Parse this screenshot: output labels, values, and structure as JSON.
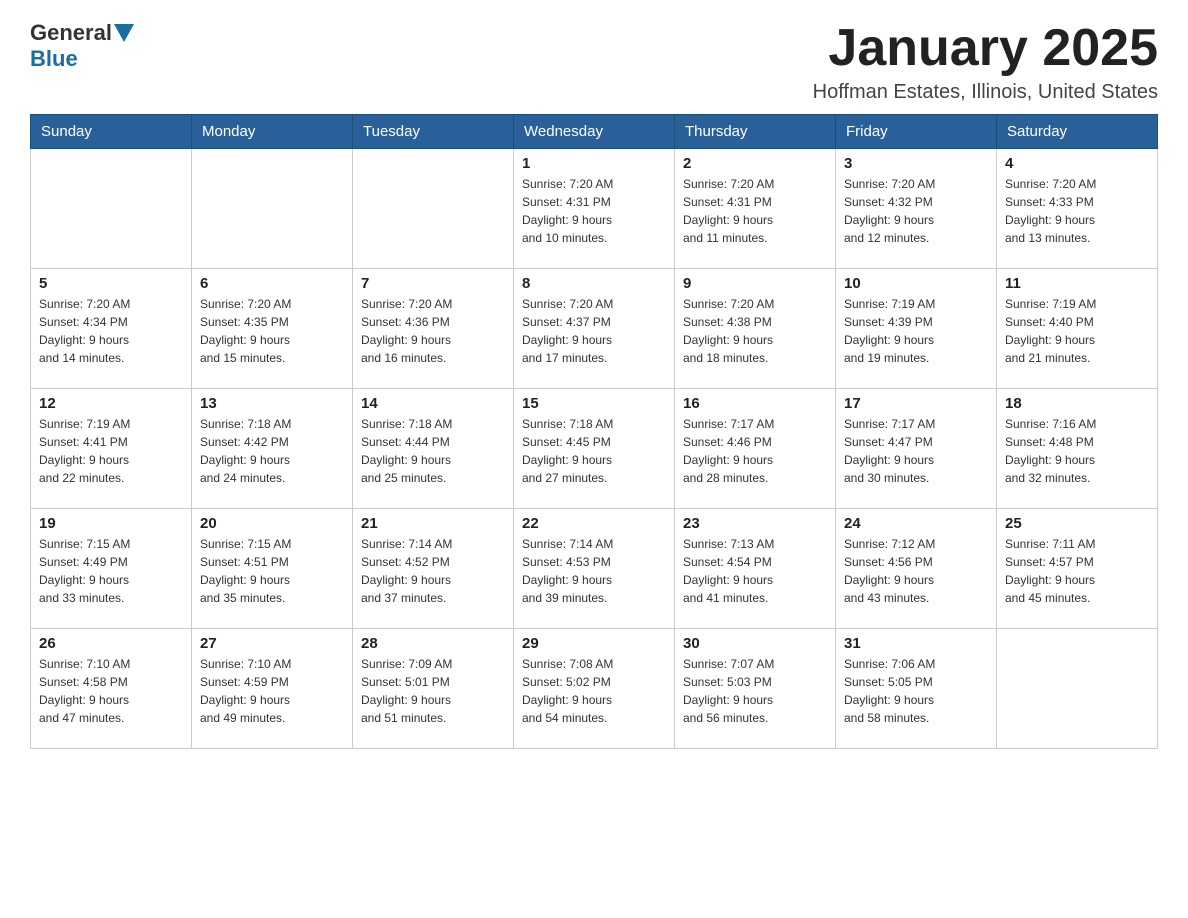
{
  "header": {
    "logo_general": "General",
    "logo_blue": "Blue",
    "month_title": "January 2025",
    "location": "Hoffman Estates, Illinois, United States"
  },
  "columns": [
    "Sunday",
    "Monday",
    "Tuesday",
    "Wednesday",
    "Thursday",
    "Friday",
    "Saturday"
  ],
  "weeks": [
    {
      "days": [
        {
          "date": "",
          "info": ""
        },
        {
          "date": "",
          "info": ""
        },
        {
          "date": "",
          "info": ""
        },
        {
          "date": "1",
          "info": "Sunrise: 7:20 AM\nSunset: 4:31 PM\nDaylight: 9 hours\nand 10 minutes."
        },
        {
          "date": "2",
          "info": "Sunrise: 7:20 AM\nSunset: 4:31 PM\nDaylight: 9 hours\nand 11 minutes."
        },
        {
          "date": "3",
          "info": "Sunrise: 7:20 AM\nSunset: 4:32 PM\nDaylight: 9 hours\nand 12 minutes."
        },
        {
          "date": "4",
          "info": "Sunrise: 7:20 AM\nSunset: 4:33 PM\nDaylight: 9 hours\nand 13 minutes."
        }
      ]
    },
    {
      "days": [
        {
          "date": "5",
          "info": "Sunrise: 7:20 AM\nSunset: 4:34 PM\nDaylight: 9 hours\nand 14 minutes."
        },
        {
          "date": "6",
          "info": "Sunrise: 7:20 AM\nSunset: 4:35 PM\nDaylight: 9 hours\nand 15 minutes."
        },
        {
          "date": "7",
          "info": "Sunrise: 7:20 AM\nSunset: 4:36 PM\nDaylight: 9 hours\nand 16 minutes."
        },
        {
          "date": "8",
          "info": "Sunrise: 7:20 AM\nSunset: 4:37 PM\nDaylight: 9 hours\nand 17 minutes."
        },
        {
          "date": "9",
          "info": "Sunrise: 7:20 AM\nSunset: 4:38 PM\nDaylight: 9 hours\nand 18 minutes."
        },
        {
          "date": "10",
          "info": "Sunrise: 7:19 AM\nSunset: 4:39 PM\nDaylight: 9 hours\nand 19 minutes."
        },
        {
          "date": "11",
          "info": "Sunrise: 7:19 AM\nSunset: 4:40 PM\nDaylight: 9 hours\nand 21 minutes."
        }
      ]
    },
    {
      "days": [
        {
          "date": "12",
          "info": "Sunrise: 7:19 AM\nSunset: 4:41 PM\nDaylight: 9 hours\nand 22 minutes."
        },
        {
          "date": "13",
          "info": "Sunrise: 7:18 AM\nSunset: 4:42 PM\nDaylight: 9 hours\nand 24 minutes."
        },
        {
          "date": "14",
          "info": "Sunrise: 7:18 AM\nSunset: 4:44 PM\nDaylight: 9 hours\nand 25 minutes."
        },
        {
          "date": "15",
          "info": "Sunrise: 7:18 AM\nSunset: 4:45 PM\nDaylight: 9 hours\nand 27 minutes."
        },
        {
          "date": "16",
          "info": "Sunrise: 7:17 AM\nSunset: 4:46 PM\nDaylight: 9 hours\nand 28 minutes."
        },
        {
          "date": "17",
          "info": "Sunrise: 7:17 AM\nSunset: 4:47 PM\nDaylight: 9 hours\nand 30 minutes."
        },
        {
          "date": "18",
          "info": "Sunrise: 7:16 AM\nSunset: 4:48 PM\nDaylight: 9 hours\nand 32 minutes."
        }
      ]
    },
    {
      "days": [
        {
          "date": "19",
          "info": "Sunrise: 7:15 AM\nSunset: 4:49 PM\nDaylight: 9 hours\nand 33 minutes."
        },
        {
          "date": "20",
          "info": "Sunrise: 7:15 AM\nSunset: 4:51 PM\nDaylight: 9 hours\nand 35 minutes."
        },
        {
          "date": "21",
          "info": "Sunrise: 7:14 AM\nSunset: 4:52 PM\nDaylight: 9 hours\nand 37 minutes."
        },
        {
          "date": "22",
          "info": "Sunrise: 7:14 AM\nSunset: 4:53 PM\nDaylight: 9 hours\nand 39 minutes."
        },
        {
          "date": "23",
          "info": "Sunrise: 7:13 AM\nSunset: 4:54 PM\nDaylight: 9 hours\nand 41 minutes."
        },
        {
          "date": "24",
          "info": "Sunrise: 7:12 AM\nSunset: 4:56 PM\nDaylight: 9 hours\nand 43 minutes."
        },
        {
          "date": "25",
          "info": "Sunrise: 7:11 AM\nSunset: 4:57 PM\nDaylight: 9 hours\nand 45 minutes."
        }
      ]
    },
    {
      "days": [
        {
          "date": "26",
          "info": "Sunrise: 7:10 AM\nSunset: 4:58 PM\nDaylight: 9 hours\nand 47 minutes."
        },
        {
          "date": "27",
          "info": "Sunrise: 7:10 AM\nSunset: 4:59 PM\nDaylight: 9 hours\nand 49 minutes."
        },
        {
          "date": "28",
          "info": "Sunrise: 7:09 AM\nSunset: 5:01 PM\nDaylight: 9 hours\nand 51 minutes."
        },
        {
          "date": "29",
          "info": "Sunrise: 7:08 AM\nSunset: 5:02 PM\nDaylight: 9 hours\nand 54 minutes."
        },
        {
          "date": "30",
          "info": "Sunrise: 7:07 AM\nSunset: 5:03 PM\nDaylight: 9 hours\nand 56 minutes."
        },
        {
          "date": "31",
          "info": "Sunrise: 7:06 AM\nSunset: 5:05 PM\nDaylight: 9 hours\nand 58 minutes."
        },
        {
          "date": "",
          "info": ""
        }
      ]
    }
  ]
}
